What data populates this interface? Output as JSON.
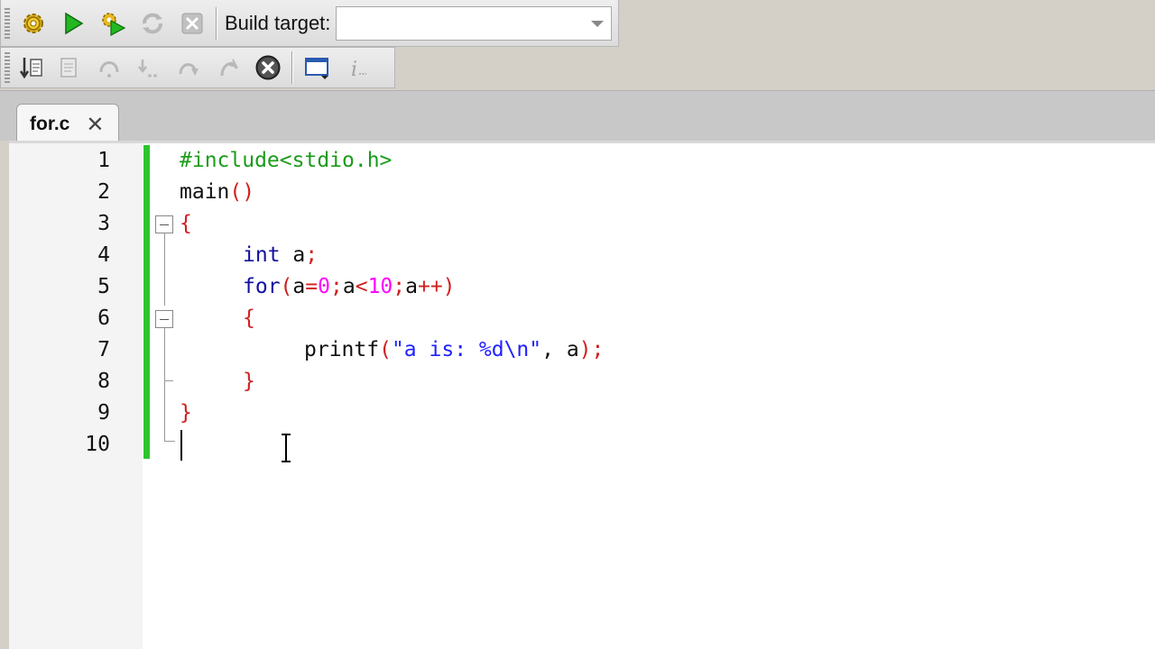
{
  "toolbar": {
    "build_target_label": "Build target:",
    "build_target_value": ""
  },
  "tab": {
    "filename": "for.c",
    "close_glyph": "✕"
  },
  "editor": {
    "line_numbers": [
      "1",
      "2",
      "3",
      "4",
      "5",
      "6",
      "7",
      "8",
      "9",
      "10"
    ],
    "lines": {
      "l1": "#include<stdio.h>",
      "l2_a": "main",
      "l2_b": "()",
      "l3": "{",
      "l4_kw": "int",
      "l4_rest": " a",
      "l4_semi": ";",
      "l5_kw": "for",
      "l5_p1": "(",
      "l5_a1": "a",
      "l5_eq": "=",
      "l5_n0": "0",
      "l5_s1": ";",
      "l5_a2": "a",
      "l5_lt": "<",
      "l5_n10": "10",
      "l5_s2": ";",
      "l5_a3": "a",
      "l5_pp": "++)",
      "l6": "{",
      "l7_fn": "printf",
      "l7_p": "(",
      "l7_str": "\"a is: %d\\n\"",
      "l7_rest1": ", a",
      "l7_end": ");",
      "l8": "}",
      "l9": "}"
    }
  },
  "colors": {
    "change_bar": "#2ec52e",
    "preprocessor": "#1a9c1a",
    "keyword": "#1010a0",
    "operator": "#d02020",
    "number": "#ff00ff",
    "string": "#2020ff"
  },
  "icons": [
    "build-gear-icon",
    "run-icon",
    "build-and-run-icon",
    "rebuild-icon",
    "abort-icon",
    "debug-step-icon",
    "debug-next-icon",
    "debug-step-into-icon",
    "debug-step-out-icon",
    "debug-next-instruction-icon",
    "debug-break-icon",
    "stop-debugger-icon",
    "debugging-windows-icon",
    "info-icon"
  ]
}
